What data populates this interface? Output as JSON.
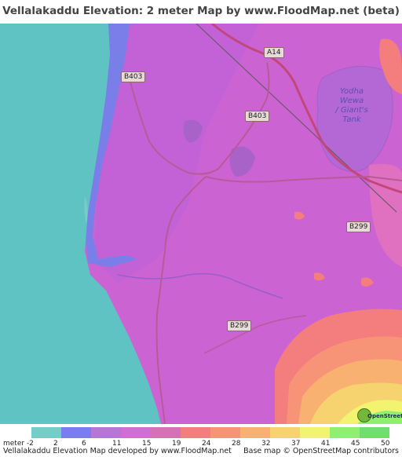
{
  "title": "Vellalakaddu Elevation: 2 meter Map by www.FloodMap.net (beta)",
  "map": {
    "road_labels": [
      "A14",
      "B403",
      "B403",
      "B299",
      "B299"
    ],
    "lake_label_lines": [
      "Yodha",
      "Wewa",
      "/ Giant's",
      "Tank"
    ],
    "osm_logo_text": "OpenStreetMap"
  },
  "legend": {
    "unit_label": "meter -2",
    "ticks": [
      "2",
      "6",
      "11",
      "15",
      "19",
      "24",
      "28",
      "32",
      "37",
      "41",
      "45",
      "50"
    ],
    "colors": [
      "#74cdc6",
      "#7b7bf2",
      "#b576d6",
      "#cf6fd2",
      "#d671b6",
      "#f47d7d",
      "#f79478",
      "#f8b170",
      "#f7d370",
      "#f2f36f",
      "#8ef06e",
      "#6fe06f"
    ]
  },
  "footer": {
    "left": "Vellalakaddu Elevation Map developed by www.FloodMap.net",
    "right": "Base map © OpenStreetMap contributors"
  },
  "colors": {
    "sea": "#60c3c3",
    "land": "#cc63d2",
    "lowland": "#b060d8",
    "coastal": "#7a7ee8",
    "highland": "#f07b7b"
  }
}
